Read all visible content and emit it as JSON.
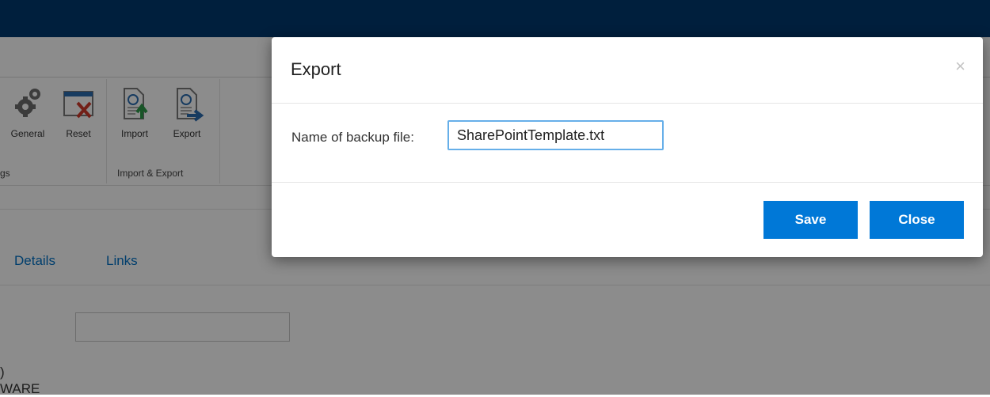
{
  "ribbon": {
    "buttons": [
      {
        "label": "General",
        "icon": "gear-icon"
      },
      {
        "label": "Reset",
        "icon": "reset-icon"
      },
      {
        "label": "Import",
        "icon": "import-icon"
      },
      {
        "label": "Export",
        "icon": "export-icon"
      }
    ],
    "groups": {
      "settings_fragment": "gs",
      "import_export": "Import & Export"
    }
  },
  "tabs": [
    {
      "label": "Details"
    },
    {
      "label": "Links"
    }
  ],
  "background_text": {
    "line1": ")",
    "line2": "WARE"
  },
  "dialog": {
    "title": "Export",
    "close_glyph": "×",
    "field_label": "Name of backup file:",
    "filename_value": "SharePointTemplate.txt",
    "save_label": "Save",
    "close_label": "Close"
  },
  "colors": {
    "topbar": "#003a70",
    "accent": "#0078d7",
    "link": "#0072c6"
  }
}
